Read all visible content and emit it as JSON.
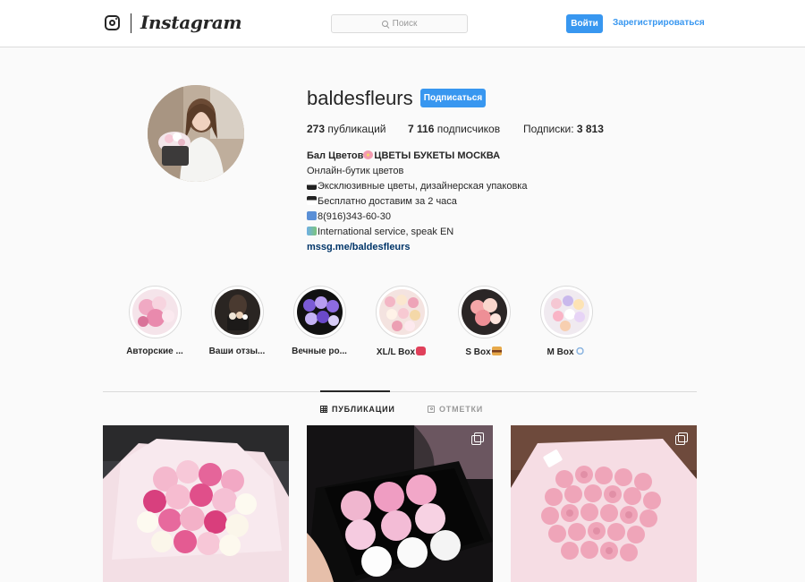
{
  "nav": {
    "wordmark": "Instagram",
    "search_placeholder": "Поиск",
    "login_label": "Войти",
    "signup_label": "Зарегистрироваться"
  },
  "profile": {
    "username": "baldesfleurs",
    "follow_label": "Подписаться",
    "posts_count": "273",
    "posts_label": "публикаций",
    "followers_count": "7 116",
    "followers_label": "подписчиков",
    "following_label": "Подписки:",
    "following_count": "3 813",
    "bio": {
      "name": "Бал Цветов",
      "name_suffix": "ЦВЕТЫ БУКЕТЫ МОСКВА",
      "line1": "Онлайн-бутик цветов",
      "line2": "Эксклюзивные цветы, дизайнерская упаковка",
      "line3": "Бесплатно доставим за 2 часа",
      "line4": "8(916)343-60-30",
      "line5": "International service, speak EN",
      "link": "mssg.me/baldesfleurs"
    }
  },
  "highlights": [
    {
      "label": "Авторские ..."
    },
    {
      "label": "Ваши отзы..."
    },
    {
      "label": "Вечные ро..."
    },
    {
      "label": "XL/L Box"
    },
    {
      "label": "S Box"
    },
    {
      "label": "M Box"
    }
  ],
  "tabs": {
    "posts_label": "ПУБЛИКАЦИИ",
    "tagged_label": "ОТМЕТКИ"
  },
  "icons": {
    "logo": "instagram-glyph-icon",
    "search": "search-icon",
    "posts_tab": "grid-icon",
    "tagged_tab": "tag-icon",
    "carousel": "multiple-photos-icon"
  },
  "colors": {
    "accent": "#3897f0",
    "link": "#003569",
    "border": "#dbdbdb",
    "background": "#fafafa"
  }
}
